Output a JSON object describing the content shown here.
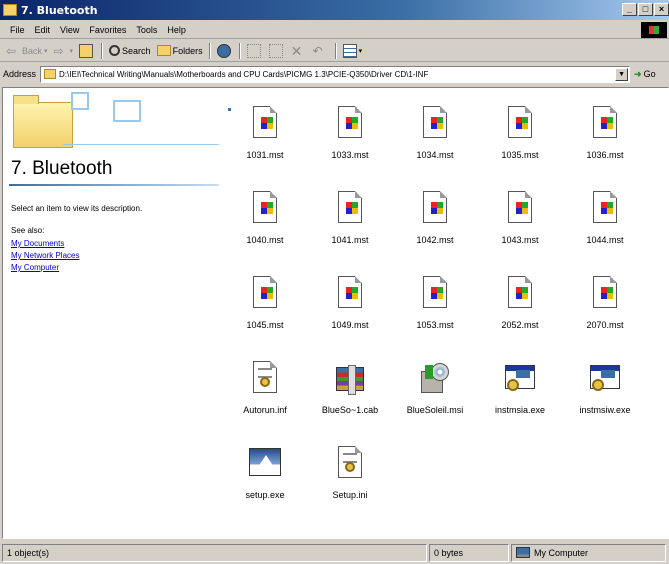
{
  "window": {
    "title": "7. Bluetooth",
    "buttons": [
      "_",
      "□",
      "×"
    ]
  },
  "menu": [
    "File",
    "Edit",
    "View",
    "Favorites",
    "Tools",
    "Help"
  ],
  "toolbar": {
    "back": "Back",
    "search": "Search",
    "folders": "Folders"
  },
  "address": {
    "label": "Address",
    "value": "D:\\IEI\\Technical Writing\\Manuals\\Motherboards and CPU Cards\\PICMG 1.3\\PCIE-Q350\\Driver CD\\1-INF",
    "go": "Go"
  },
  "leftpane": {
    "title": "7. Bluetooth",
    "description": "Select an item to view its description.",
    "see_also": "See also:",
    "links": [
      "My Documents",
      "My Network Places",
      "My Computer"
    ]
  },
  "files": [
    {
      "name": "1031.mst",
      "icon": "mst-file-icon"
    },
    {
      "name": "1033.mst",
      "icon": "mst-file-icon"
    },
    {
      "name": "1034.mst",
      "icon": "mst-file-icon"
    },
    {
      "name": "1035.mst",
      "icon": "mst-file-icon"
    },
    {
      "name": "1036.mst",
      "icon": "mst-file-icon"
    },
    {
      "name": "1040.mst",
      "icon": "mst-file-icon"
    },
    {
      "name": "1041.mst",
      "icon": "mst-file-icon"
    },
    {
      "name": "1042.mst",
      "icon": "mst-file-icon"
    },
    {
      "name": "1043.mst",
      "icon": "mst-file-icon"
    },
    {
      "name": "1044.mst",
      "icon": "mst-file-icon"
    },
    {
      "name": "1045.mst",
      "icon": "mst-file-icon"
    },
    {
      "name": "1049.mst",
      "icon": "mst-file-icon"
    },
    {
      "name": "1053.mst",
      "icon": "mst-file-icon"
    },
    {
      "name": "2052.mst",
      "icon": "mst-file-icon"
    },
    {
      "name": "2070.mst",
      "icon": "mst-file-icon"
    },
    {
      "name": "Autorun.inf",
      "icon": "inf-file-icon"
    },
    {
      "name": "BlueSo~1.cab",
      "icon": "cab-archive-icon"
    },
    {
      "name": "BlueSoleil.msi",
      "icon": "msi-installer-icon"
    },
    {
      "name": "instmsia.exe",
      "icon": "exe-program-icon"
    },
    {
      "name": "instmsiw.exe",
      "icon": "exe-program-icon"
    },
    {
      "name": "setup.exe",
      "icon": "setup-exe-icon"
    },
    {
      "name": "Setup.ini",
      "icon": "ini-file-icon"
    }
  ],
  "status": {
    "selection": "1 object(s)",
    "size": "0 bytes",
    "location": "My Computer"
  }
}
